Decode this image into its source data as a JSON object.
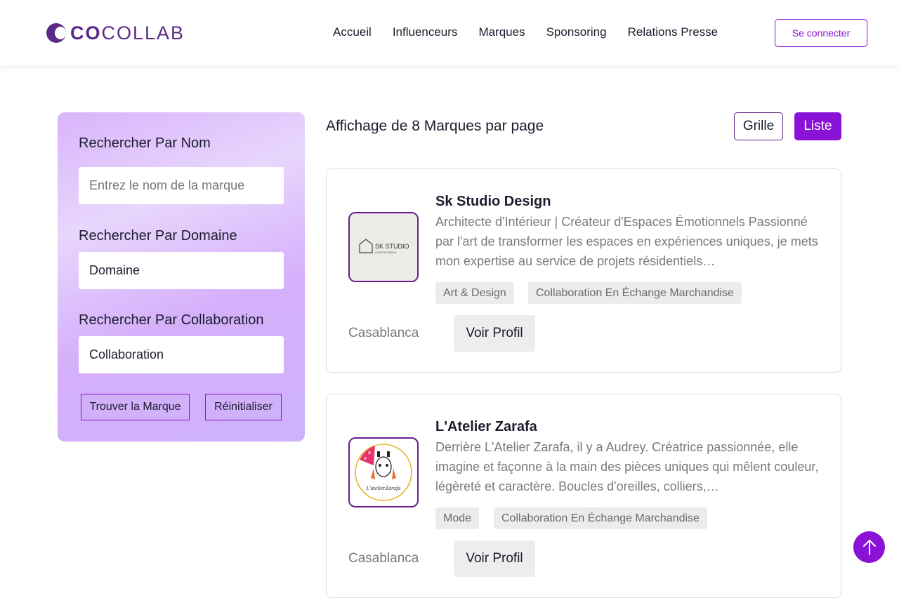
{
  "brand": {
    "name_bold": "CO",
    "name_rest": "COLLAB",
    "accent": "#8a12d6",
    "brand_color": "#5b2a86"
  },
  "nav": {
    "items": [
      "Accueil",
      "Influenceurs",
      "Marques",
      "Sponsoring",
      "Relations Presse"
    ],
    "login_label": "Se connecter"
  },
  "filters": {
    "name_label": "Rechercher Par Nom",
    "name_placeholder": "Entrez le nom de la marque",
    "domain_label": "Rechercher Par Domaine",
    "domain_value": "Domaine",
    "collab_label": "Rechercher Par Collaboration",
    "collab_value": "Collaboration",
    "find_button": "Trouver la Marque",
    "reset_button": "Réinitialiser"
  },
  "results": {
    "title": "Affichage de 8 Marques par page",
    "grid_label": "Grille",
    "list_label": "Liste"
  },
  "brands": [
    {
      "name": "Sk Studio Design",
      "logo_text": "SK STUDIO",
      "logo_subtext": "INTERIOR DESIGN",
      "description": "Architecte d'Intérieur | Créateur d'Espaces Émotionnels Passionné par l'art de transformer les espaces en expériences uniques, je mets mon expertise au service de projets résidentiels…",
      "tags": [
        "Art & Design",
        "Collaboration En Échange Marchandise"
      ],
      "city": "Casablanca",
      "button": "Voir Profil"
    },
    {
      "name": "L'Atelier Zarafa",
      "logo_text": "L'atelierZarafa",
      "description": "Derrière L'Atelier Zarafa, il y a Audrey. Créatrice passionnée, elle imagine et façonne à la main des pièces uniques qui mêlent couleur, légèreté et caractère. Boucles d'oreilles, colliers,…",
      "tags": [
        "Mode",
        "Collaboration En Échange Marchandise"
      ],
      "city": "Casablanca",
      "button": "Voir Profil"
    }
  ]
}
